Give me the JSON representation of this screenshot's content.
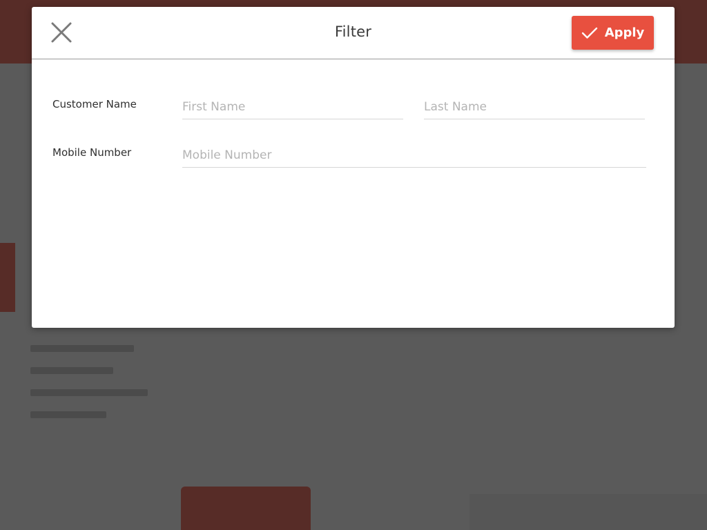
{
  "modal": {
    "title": "Filter",
    "apply_label": "Apply"
  },
  "fields": {
    "customer_name_label": "Customer Name",
    "first_name_placeholder": "First Name",
    "last_name_placeholder": "Last Name",
    "mobile_label": "Mobile Number",
    "mobile_placeholder": "Mobile Number"
  },
  "icons": {
    "close": "close-icon",
    "check": "check-icon"
  },
  "colors": {
    "accent": "#e8503f",
    "overlay": "#5a5a5a"
  }
}
